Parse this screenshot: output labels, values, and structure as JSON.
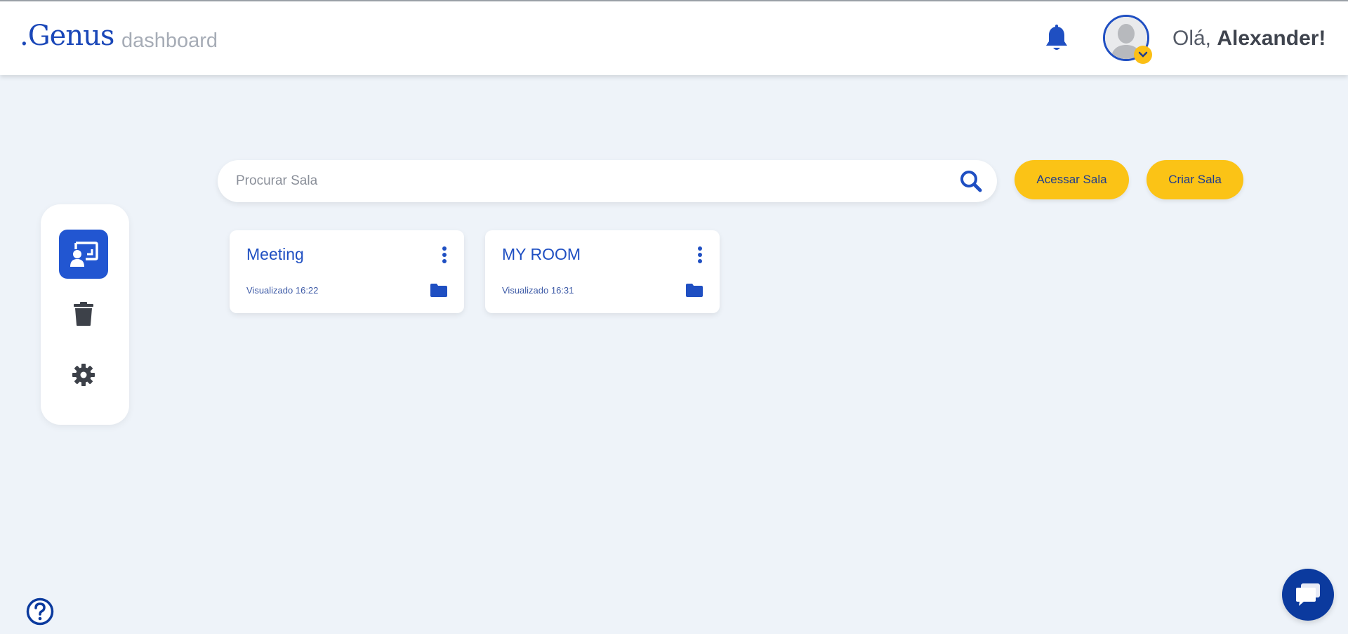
{
  "header": {
    "logo": ".Genus",
    "subtitle": "dashboard",
    "greeting_prefix": "Olá, ",
    "user_name": "Alexander!"
  },
  "search": {
    "placeholder": "Procurar Sala",
    "value": ""
  },
  "actions": {
    "access_label": "Acessar Sala",
    "create_label": "Criar Sala"
  },
  "sidebar": {
    "items": [
      {
        "name": "rooms",
        "icon": "presentation-icon",
        "active": true
      },
      {
        "name": "trash",
        "icon": "trash-icon",
        "active": false
      },
      {
        "name": "settings",
        "icon": "gear-icon",
        "active": false
      }
    ]
  },
  "rooms": [
    {
      "title": "Meeting",
      "viewed": "Visualizado 16:22"
    },
    {
      "title": "MY ROOM",
      "viewed": "Visualizado 16:31"
    }
  ],
  "colors": {
    "primary": "#1f4fc2",
    "accent": "#fbc316",
    "background": "#eef3f9"
  }
}
